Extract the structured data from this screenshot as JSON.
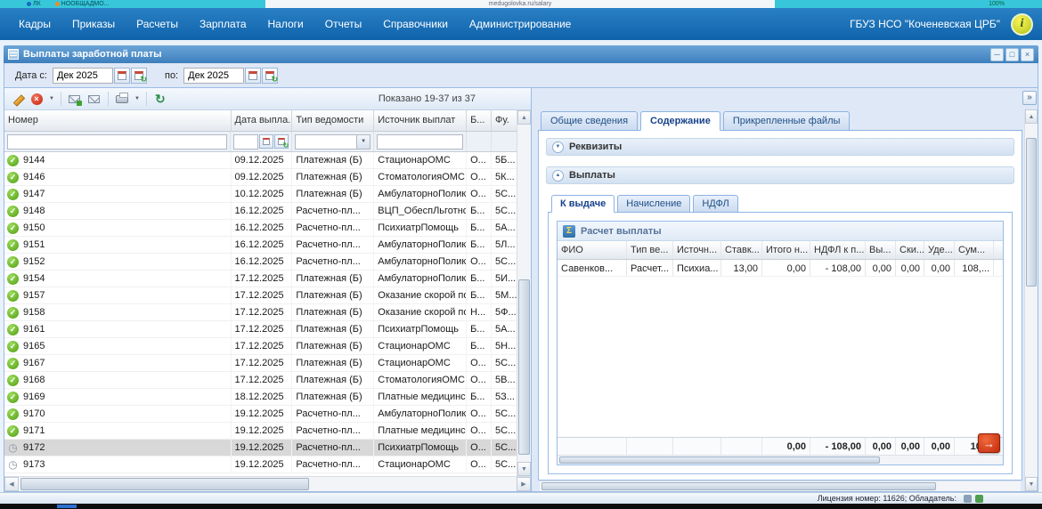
{
  "browser_strip": {
    "tab1": "ЛК",
    "tab2": "НООБЩАДМО...",
    "url": "medugolovka.ru/salary",
    "zoom": "100%"
  },
  "menubar": {
    "items": [
      {
        "label": "Кадры"
      },
      {
        "label": "Приказы"
      },
      {
        "label": "Расчеты"
      },
      {
        "label": "Зарплата"
      },
      {
        "label": "Налоги"
      },
      {
        "label": "Отчеты"
      },
      {
        "label": "Справочники"
      },
      {
        "label": "Администрирование"
      }
    ],
    "organization": "ГБУЗ НСО \"Коченевская ЦРБ\""
  },
  "window": {
    "title": "Выплаты заработной платы"
  },
  "filterbar": {
    "from_label": "Дата с:",
    "from_value": "Дек 2025",
    "to_label": "по:",
    "to_value": "Дек 2025"
  },
  "toolbar": {
    "shown": "Показано 19-37 из 37"
  },
  "grid": {
    "columns": [
      "Номер",
      "Дата выпла...",
      "Тип ведомости",
      "Источник выплат",
      "Б...",
      "Фу."
    ],
    "rows": [
      {
        "number": "9144",
        "date": "09.12.2025",
        "type": "Платежная (Б)",
        "source": "СтационарОМС",
        "b": "О...",
        "f": "5Б...",
        "status": "approved"
      },
      {
        "number": "9146",
        "date": "09.12.2025",
        "type": "Платежная (Б)",
        "source": "СтоматологияОМС",
        "b": "О...",
        "f": "5К...",
        "status": "approved"
      },
      {
        "number": "9147",
        "date": "10.12.2025",
        "type": "Платежная (Б)",
        "source": "АмбулаторноПолик...",
        "b": "О...",
        "f": "5С...",
        "status": "approved"
      },
      {
        "number": "9148",
        "date": "16.12.2025",
        "type": "Расчетно-пл...",
        "source": "ВЦП_ОбеспЛьготно...",
        "b": "Б...",
        "f": "5С...",
        "status": "approved"
      },
      {
        "number": "9150",
        "date": "16.12.2025",
        "type": "Расчетно-пл...",
        "source": "ПсихиатрПомощь",
        "b": "Б...",
        "f": "5А...",
        "status": "approved"
      },
      {
        "number": "9151",
        "date": "16.12.2025",
        "type": "Расчетно-пл...",
        "source": "АмбулаторноПолик...",
        "b": "Б...",
        "f": "5Л...",
        "status": "approved"
      },
      {
        "number": "9152",
        "date": "16.12.2025",
        "type": "Расчетно-пл...",
        "source": "АмбулаторноПолик...",
        "b": "О...",
        "f": "5С...",
        "status": "approved"
      },
      {
        "number": "9154",
        "date": "17.12.2025",
        "type": "Платежная (Б)",
        "source": "АмбулаторноПолик...",
        "b": "Б...",
        "f": "5И...",
        "status": "approved"
      },
      {
        "number": "9157",
        "date": "17.12.2025",
        "type": "Платежная (Б)",
        "source": "Оказание скорой по...",
        "b": "Б...",
        "f": "5М...",
        "status": "approved"
      },
      {
        "number": "9158",
        "date": "17.12.2025",
        "type": "Платежная (Б)",
        "source": "Оказание скорой по...",
        "b": "Н...",
        "f": "5Ф...",
        "status": "approved"
      },
      {
        "number": "9161",
        "date": "17.12.2025",
        "type": "Платежная (Б)",
        "source": "ПсихиатрПомощь",
        "b": "Б...",
        "f": "5А...",
        "status": "approved"
      },
      {
        "number": "9165",
        "date": "17.12.2025",
        "type": "Платежная (Б)",
        "source": "СтационарОМС",
        "b": "Б...",
        "f": "5Н...",
        "status": "approved"
      },
      {
        "number": "9167",
        "date": "17.12.2025",
        "type": "Платежная (Б)",
        "source": "СтационарОМС",
        "b": "О...",
        "f": "5С...",
        "status": "approved"
      },
      {
        "number": "9168",
        "date": "17.12.2025",
        "type": "Платежная (Б)",
        "source": "СтоматологияОМС",
        "b": "О...",
        "f": "5В...",
        "status": "approved"
      },
      {
        "number": "9169",
        "date": "18.12.2025",
        "type": "Платежная (Б)",
        "source": "Платные медицинск...",
        "b": "Б...",
        "f": "5З...",
        "status": "approved"
      },
      {
        "number": "9170",
        "date": "19.12.2025",
        "type": "Расчетно-пл...",
        "source": "АмбулаторноПолик...",
        "b": "О...",
        "f": "5С...",
        "status": "approved"
      },
      {
        "number": "9171",
        "date": "19.12.2025",
        "type": "Расчетно-пл...",
        "source": "Платные медицинск...",
        "b": "О...",
        "f": "5С...",
        "status": "approved"
      },
      {
        "number": "9172",
        "date": "19.12.2025",
        "type": "Расчетно-пл...",
        "source": "ПсихиатрПомощь",
        "b": "О...",
        "f": "5С...",
        "status": "pending",
        "selected": true
      },
      {
        "number": "9173",
        "date": "19.12.2025",
        "type": "Расчетно-пл...",
        "source": "СтационарОМС",
        "b": "О...",
        "f": "5С...",
        "status": "pending"
      }
    ]
  },
  "detail": {
    "tabs": [
      {
        "label": "Общие сведения"
      },
      {
        "label": "Содержание",
        "active": true
      },
      {
        "label": "Прикрепленные файлы"
      }
    ],
    "sections": {
      "requisites": "Реквизиты",
      "payments": "Выплаты"
    },
    "payment_tabs": [
      {
        "label": "К выдаче",
        "active": true
      },
      {
        "label": "Начисление"
      },
      {
        "label": "НДФЛ"
      }
    ],
    "calc": {
      "title": "Расчет выплаты",
      "columns": [
        "ФИО",
        "Тип ве...",
        "Источн...",
        "Ставк...",
        "Итого н...",
        "НДФЛ к п...",
        "Вы...",
        "Ски...",
        "Уде...",
        "Сум..."
      ],
      "row": [
        "Савенков...",
        "Расчет...",
        "Психиа...",
        "13,00",
        "0,00",
        "- 108,00",
        "0,00",
        "0,00",
        "0,00",
        "108,..."
      ],
      "totals": [
        "",
        "",
        "",
        "",
        "0,00",
        "- 108,00",
        "0,00",
        "0,00",
        "0,00",
        "10..."
      ]
    }
  },
  "statusbar": {
    "license": "Лицензия номер: 11626; Обладатель:"
  }
}
